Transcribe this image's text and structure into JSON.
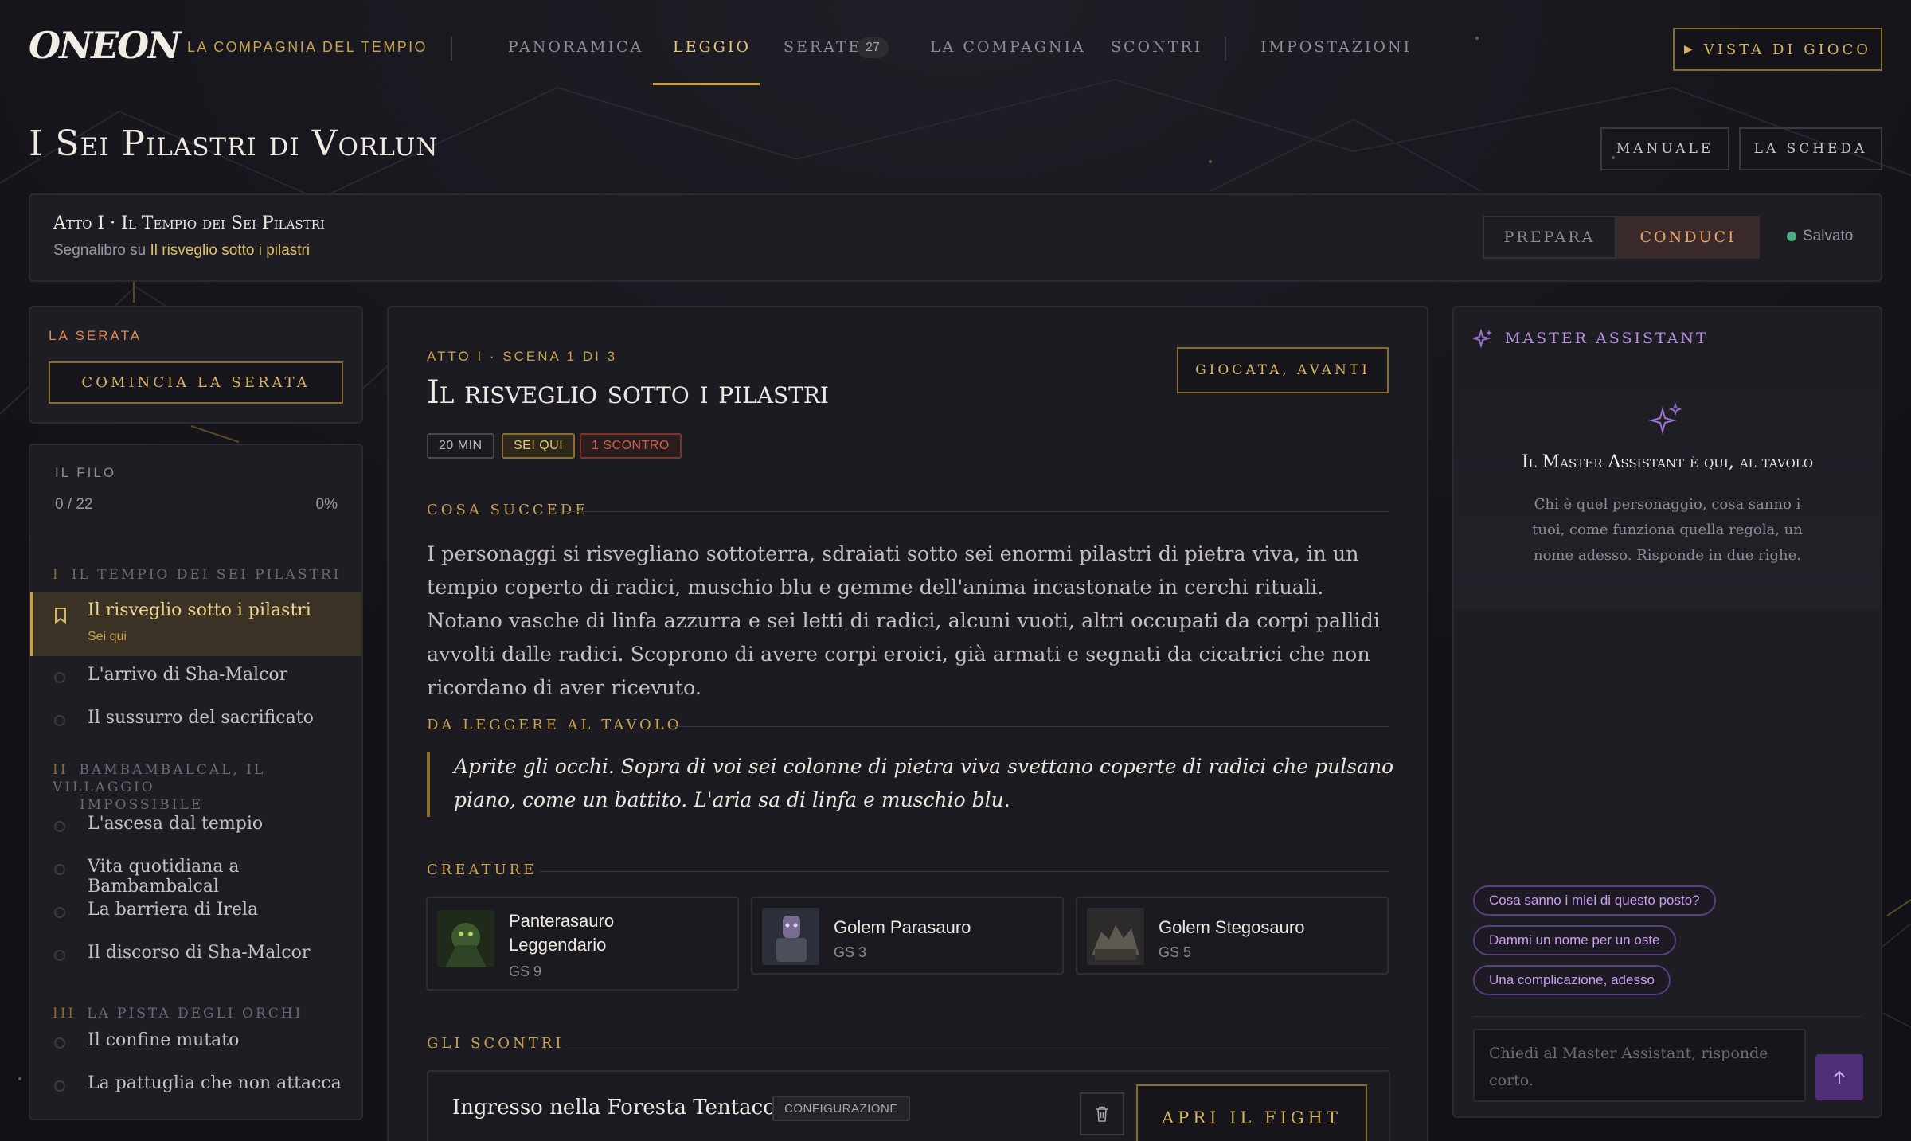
{
  "header": {
    "logo": "ONEON",
    "company": "La Compagnia del Tempio",
    "nav": [
      "Panoramica",
      "Leggio",
      "Serate",
      "La Compagnia",
      "Scontri",
      "Impostazioni"
    ],
    "active_nav": "Leggio",
    "serate_count": "27",
    "game_view_button": "Vista di Gioco"
  },
  "page": {
    "title": "I Sei Pilastri di Vorlun",
    "manual_button": "Manuale",
    "sheet_button": "La Scheda"
  },
  "act_bar": {
    "title": "Atto I · Il Tempio dei Sei Pilastri",
    "bookmark_prefix": "Segnalibro su",
    "bookmark_link": "Il risveglio sotto i pilastri",
    "mode_prepare": "Prepara",
    "mode_run": "Conduci",
    "active_mode": "Conduci",
    "save_status": "Salvato"
  },
  "evening": {
    "label": "La Serata",
    "start_button": "Comincia la serata"
  },
  "thread": {
    "label": "Il Filo",
    "progress_text": "0 / 22",
    "percent": "0%",
    "sections": [
      {
        "roman": "I",
        "title": "Il Tempio dei Sei Pilastri",
        "items": [
          {
            "label": "Il risveglio sotto i pilastri",
            "current": true,
            "current_label": "Sei qui"
          },
          {
            "label": "L'arrivo di Sha-Malcor"
          },
          {
            "label": "Il sussurro del sacrificato"
          }
        ]
      },
      {
        "roman": "II",
        "title_line1": "Bambambalcal, il villaggio",
        "title_line2": "impossibile",
        "items": [
          {
            "label": "L'ascesa dal tempio"
          },
          {
            "label": "Vita quotidiana a Bambambalcal"
          },
          {
            "label": "La barriera di Irela"
          },
          {
            "label": "Il discorso di Sha-Malcor"
          }
        ]
      },
      {
        "roman": "III",
        "title": "La pista degli orchi",
        "items": [
          {
            "label": "Il confine mutato"
          },
          {
            "label": "La pattuglia che non attacca"
          }
        ]
      }
    ]
  },
  "scene": {
    "kicker": "Atto I · Scena 1 di 3",
    "title": "Il risveglio sotto i pilastri",
    "played_button": "Giocata, avanti",
    "tags": [
      "20 min",
      "Sei qui",
      "1 scontro"
    ],
    "what_happens_label": "Cosa succede",
    "what_happens_text": "I personaggi si risvegliano sottoterra, sdraiati sotto sei enormi pilastri di pietra viva, in un tempio coperto di radici, muschio blu e gemme dell'anima incastonate in cerchi rituali. Notano vasche di linfa azzurra e sei letti di radici, alcuni vuoti, altri occupati da corpi pallidi avvolti dalle radici. Scoprono di avere corpi eroici, già armati e segnati da cicatrici che non ricordano di aver ricevuto.",
    "read_aloud_label": "Da leggere al tavolo",
    "read_aloud_text": "Aprite gli occhi. Sopra di voi sei colonne di pietra viva svettano coperte di radici che pulsano piano, come un battito. L'aria sa di linfa e muschio blu.",
    "creatures_label": "Creature",
    "creatures": [
      {
        "name_line1": "Panterasauro",
        "name_line2": "Leggendario",
        "gs": "GS 9"
      },
      {
        "name_line1": "Golem Parasauro",
        "gs": "GS 3"
      },
      {
        "name_line1": "Golem Stegosauro",
        "gs": "GS 5"
      }
    ],
    "encounters_label": "Gli Scontri",
    "encounter": {
      "name": "Ingresso nella Foresta Tentacolare",
      "tag": "Configurazione",
      "open_button": "Apri il fight"
    }
  },
  "assistant": {
    "label": "Master Assistant",
    "heading": "Il Master Assistant è qui, al tavolo",
    "description_lines": [
      "Chi è quel personaggio, cosa sanno i",
      "tuoi, come funziona quella regola, un",
      "nome adesso. Risponde in due righe."
    ],
    "suggestions": [
      "Cosa sanno i miei di questo posto?",
      "Dammi un nome per un oste",
      "Una complicazione, adesso"
    ],
    "input_placeholder_line1": "Chiedi al Master Assistant, risponde",
    "input_placeholder_line2": "corto."
  },
  "colors": {
    "accent_gold": "#c9a24d",
    "accent_purple": "#9a6fd0",
    "danger": "#c9503f",
    "status_green": "#4caf7f"
  }
}
